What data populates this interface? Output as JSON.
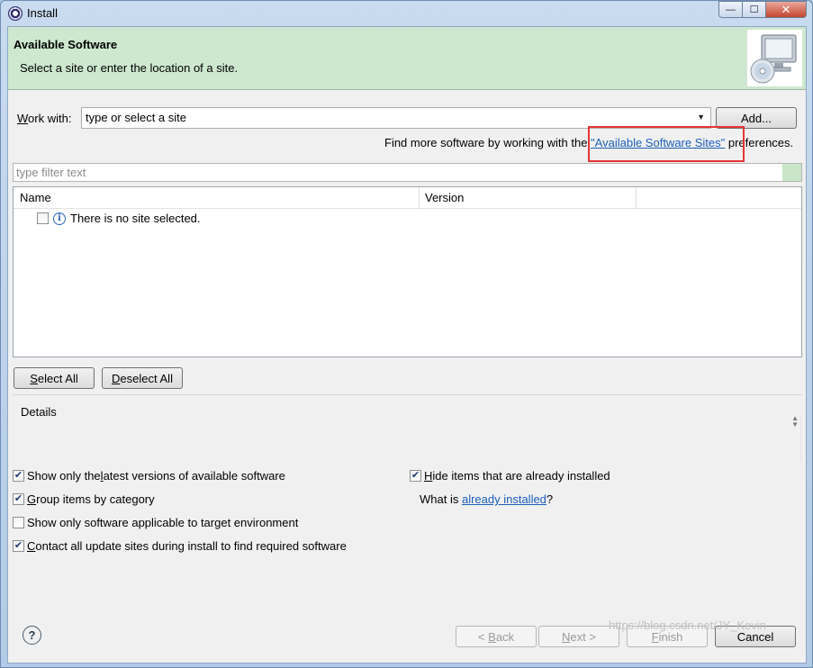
{
  "window": {
    "title": "Install",
    "minimize_glyph": "—",
    "maximize_glyph": "☐",
    "close_glyph": "✕"
  },
  "banner": {
    "title": "Available Software",
    "subtitle": "Select a site or enter the location of a site.",
    "image_icon": "monitor-cd-icon"
  },
  "work_with": {
    "label_accel": "W",
    "label_rest": "ork with:",
    "value": "type or select a site",
    "add_button": "Add..."
  },
  "find_more": {
    "prefix": "Find more software by working with the",
    "link": "\"Available Software Sites\"",
    "suffix": "preferences."
  },
  "filter": {
    "placeholder": "type filter text"
  },
  "tree": {
    "columns": [
      "Name",
      "Version"
    ],
    "rows": [
      {
        "checked": false,
        "icon": "info-icon",
        "label": "There is no site selected."
      }
    ]
  },
  "buttons": {
    "select_all_accel": "S",
    "select_all_rest": "elect All",
    "deselect_all_accel": "D",
    "deselect_all_rest": "eselect All"
  },
  "details": {
    "label": "Details"
  },
  "options": {
    "latest": {
      "checked": true,
      "pre": "Show only the ",
      "accel": "l",
      "post": "atest versions of available software"
    },
    "group": {
      "checked": true,
      "pre": "",
      "accel": "G",
      "post": "roup items by category"
    },
    "target_env": {
      "checked": false,
      "text": "Show only software applicable to target environment"
    },
    "contact": {
      "checked": true,
      "pre": "",
      "accel": "C",
      "post": "ontact all update sites during install to find required software"
    },
    "hide_installed": {
      "checked": true,
      "pre": "",
      "accel": "H",
      "post": "ide items that are already installed"
    },
    "what_is_prefix": "What is ",
    "what_is_link": "already installed",
    "what_is_suffix": "?"
  },
  "footer": {
    "help_glyph": "?",
    "back_pre": "< ",
    "back_accel": "B",
    "back_post": "ack",
    "next_accel": "N",
    "next_post": "ext >",
    "finish_accel": "F",
    "finish_post": "inish",
    "cancel": "Cancel",
    "watermark": "https://blog.csdn.net/JY_Kevin"
  }
}
